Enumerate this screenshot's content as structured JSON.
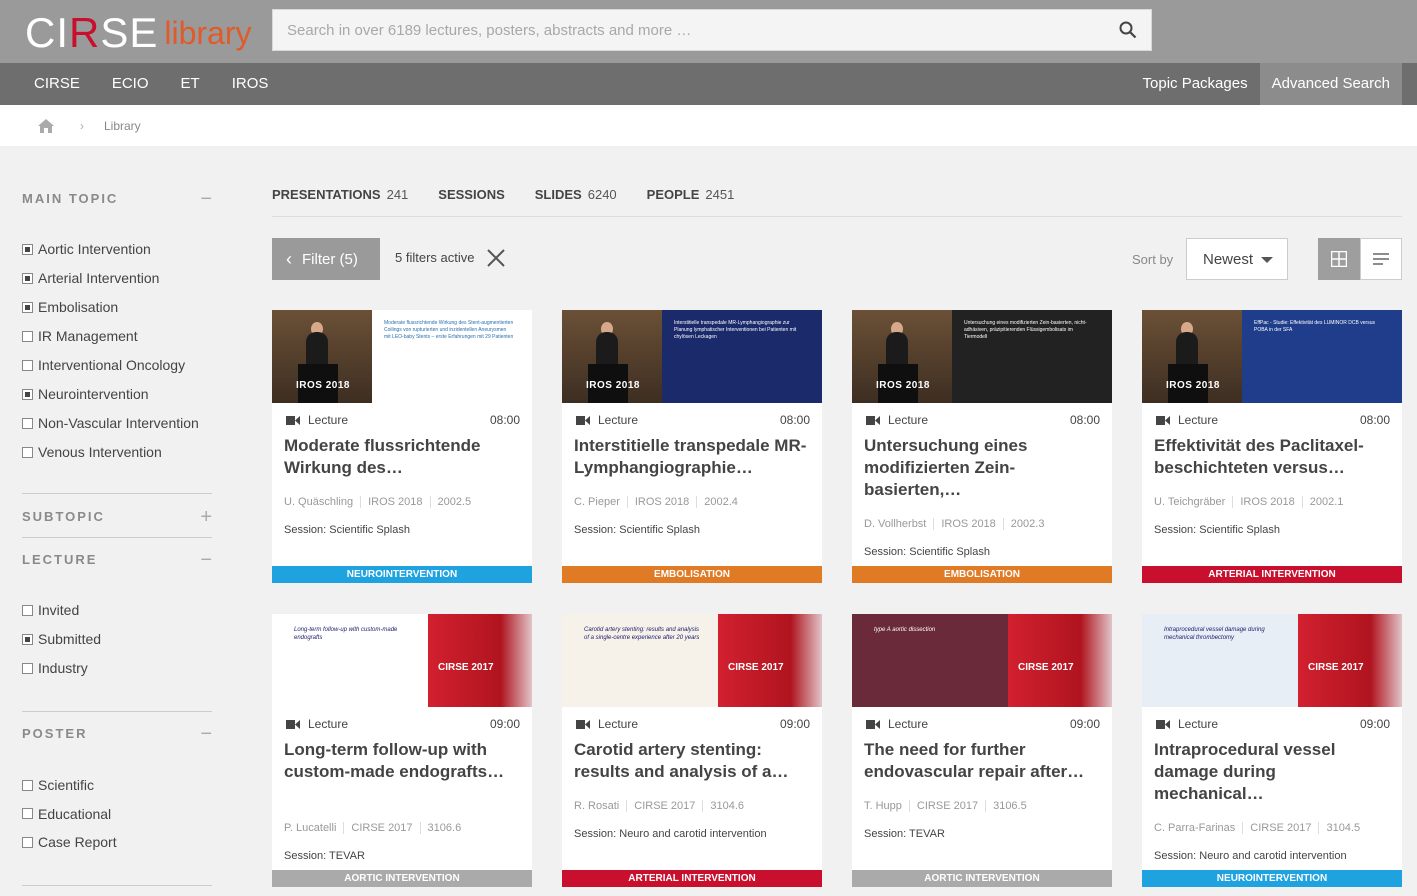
{
  "header": {
    "logo_brand_white_1": "CI",
    "logo_brand_red": "R",
    "logo_brand_white_2": "SE",
    "logo_library": "library",
    "search_placeholder": "Search in over 6189 lectures, posters, abstracts and more …"
  },
  "nav": {
    "left": [
      "CIRSE",
      "ECIO",
      "ET",
      "IROS"
    ],
    "topic_packages": "Topic Packages",
    "advanced_search": "Advanced Search"
  },
  "breadcrumb": {
    "current": "Library"
  },
  "sidebar": {
    "main_topic": {
      "title": "MAIN TOPIC",
      "toggle": "−",
      "options": [
        {
          "label": "Aortic Intervention",
          "checked": true
        },
        {
          "label": "Arterial Intervention",
          "checked": true
        },
        {
          "label": "Embolisation",
          "checked": true
        },
        {
          "label": "IR Management",
          "checked": false
        },
        {
          "label": "Interventional Oncology",
          "checked": false
        },
        {
          "label": "Neurointervention",
          "checked": true
        },
        {
          "label": "Non-Vascular Intervention",
          "checked": false
        },
        {
          "label": "Venous Intervention",
          "checked": false
        }
      ]
    },
    "subtopic": {
      "title": "SUBTOPIC",
      "toggle": "+"
    },
    "lecture": {
      "title": "LECTURE",
      "toggle": "−",
      "options": [
        {
          "label": "Invited",
          "checked": false
        },
        {
          "label": "Submitted",
          "checked": true
        },
        {
          "label": "Industry",
          "checked": false
        }
      ]
    },
    "poster": {
      "title": "POSTER",
      "toggle": "−",
      "options": [
        {
          "label": "Scientific",
          "checked": false
        },
        {
          "label": "Educational",
          "checked": false
        },
        {
          "label": "Case Report",
          "checked": false
        }
      ]
    }
  },
  "tabs": [
    {
      "label": "PRESENTATIONS",
      "count": "241"
    },
    {
      "label": "SESSIONS",
      "count": ""
    },
    {
      "label": "SLIDES",
      "count": "6240"
    },
    {
      "label": "PEOPLE",
      "count": "2451"
    }
  ],
  "toolbar": {
    "filter_label": "Filter (5)",
    "filters_active": "5 filters active",
    "sort_label": "Sort by",
    "sort_value": "Newest"
  },
  "colors": {
    "neuro": "#1ea3e0",
    "embol": "#e07a25",
    "arterial": "#c8102e",
    "aortic": "#aaaaaa"
  },
  "cards": [
    {
      "type": "Lecture",
      "time": "08:00",
      "title": "Moderate flussrichtende Wirkung des…",
      "author": "U. Quäschling",
      "event": "IROS 2018",
      "code": "2002.5",
      "session": "Session: Scientific Splash",
      "topic": "NEUROINTERVENTION",
      "color": "#1ea3e0",
      "thumb_event": "IROS 2018",
      "slide_title": "Moderate flussrichtende Wirkung des Stent-augmentierten Coilings von rupturierten und inzidentellen Aneurysmen mit LEO-baby Stents – erste Erfahrungen mit 29 Patienten"
    },
    {
      "type": "Lecture",
      "time": "08:00",
      "title": "Interstitielle transpedale MR-Lymphangiographie…",
      "author": "C. Pieper",
      "event": "IROS 2018",
      "code": "2002.4",
      "session": "Session: Scientific Splash",
      "topic": "EMBOLISATION",
      "color": "#e07a25",
      "thumb_event": "IROS 2018",
      "slide_title": "Interstitielle transpedale MR-Lymphangiographie zur Planung lymphatischer Interventionen bei Patienten mit chylösen Leckagen"
    },
    {
      "type": "Lecture",
      "time": "08:00",
      "title": "Untersuchung eines modifizierten Zein-basierten,…",
      "author": "D. Vollherbst",
      "event": "IROS 2018",
      "code": "2002.3",
      "session": "Session: Scientific Splash",
      "topic": "EMBOLISATION",
      "color": "#e07a25",
      "thumb_event": "IROS 2018",
      "slide_title": "Untersuchung eines modifizierten Zein-basierten, nicht-adhäsiven, präzipitierenden Flüssigembolisats im Tiermodell"
    },
    {
      "type": "Lecture",
      "time": "08:00",
      "title": "Effektivität des Paclitaxel-beschichteten versus…",
      "author": "U. Teichgräber",
      "event": "IROS 2018",
      "code": "2002.1",
      "session": "Session: Scientific Splash",
      "topic": "ARTERIAL INTERVENTION",
      "color": "#c8102e",
      "thumb_event": "IROS 2018",
      "slide_title": "EffPac - Studie: Effektivität des LUMINOR DCB versus POBA in der SFA"
    },
    {
      "type": "Lecture",
      "time": "09:00",
      "title": "Long-term follow-up with custom-made endografts…",
      "author": "P. Lucatelli",
      "event": "CIRSE 2017",
      "code": "3106.6",
      "session": "Session: TEVAR",
      "topic": "AORTIC INTERVENTION",
      "color": "#aaaaaa",
      "thumb_event": "CIRSE 2017",
      "slide_title": "Long-term follow-up with custom-made endografts"
    },
    {
      "type": "Lecture",
      "time": "09:00",
      "title": "Carotid artery stenting: results and analysis of a…",
      "author": "R. Rosati",
      "event": "CIRSE 2017",
      "code": "3104.6",
      "session": "Session: Neuro and carotid intervention",
      "topic": "ARTERIAL INTERVENTION",
      "color": "#c8102e",
      "thumb_event": "CIRSE 2017",
      "slide_title": "Carotid artery stenting: results and analysis of a single-centre experience after 20 years"
    },
    {
      "type": "Lecture",
      "time": "09:00",
      "title": "The need for further endovascular repair after…",
      "author": "T. Hupp",
      "event": "CIRSE 2017",
      "code": "3106.5",
      "session": "Session: TEVAR",
      "topic": "AORTIC INTERVENTION",
      "color": "#aaaaaa",
      "thumb_event": "CIRSE 2017",
      "slide_title": "type A aortic dissection"
    },
    {
      "type": "Lecture",
      "time": "09:00",
      "title": "Intraprocedural vessel damage during mechanical…",
      "author": "C. Parra-Farinas",
      "event": "CIRSE 2017",
      "code": "3104.5",
      "session": "Session: Neuro and carotid intervention",
      "topic": "NEUROINTERVENTION",
      "color": "#1ea3e0",
      "thumb_event": "CIRSE 2017",
      "slide_title": "Intraprocedural vessel damage during mechanical thrombectomy"
    }
  ]
}
